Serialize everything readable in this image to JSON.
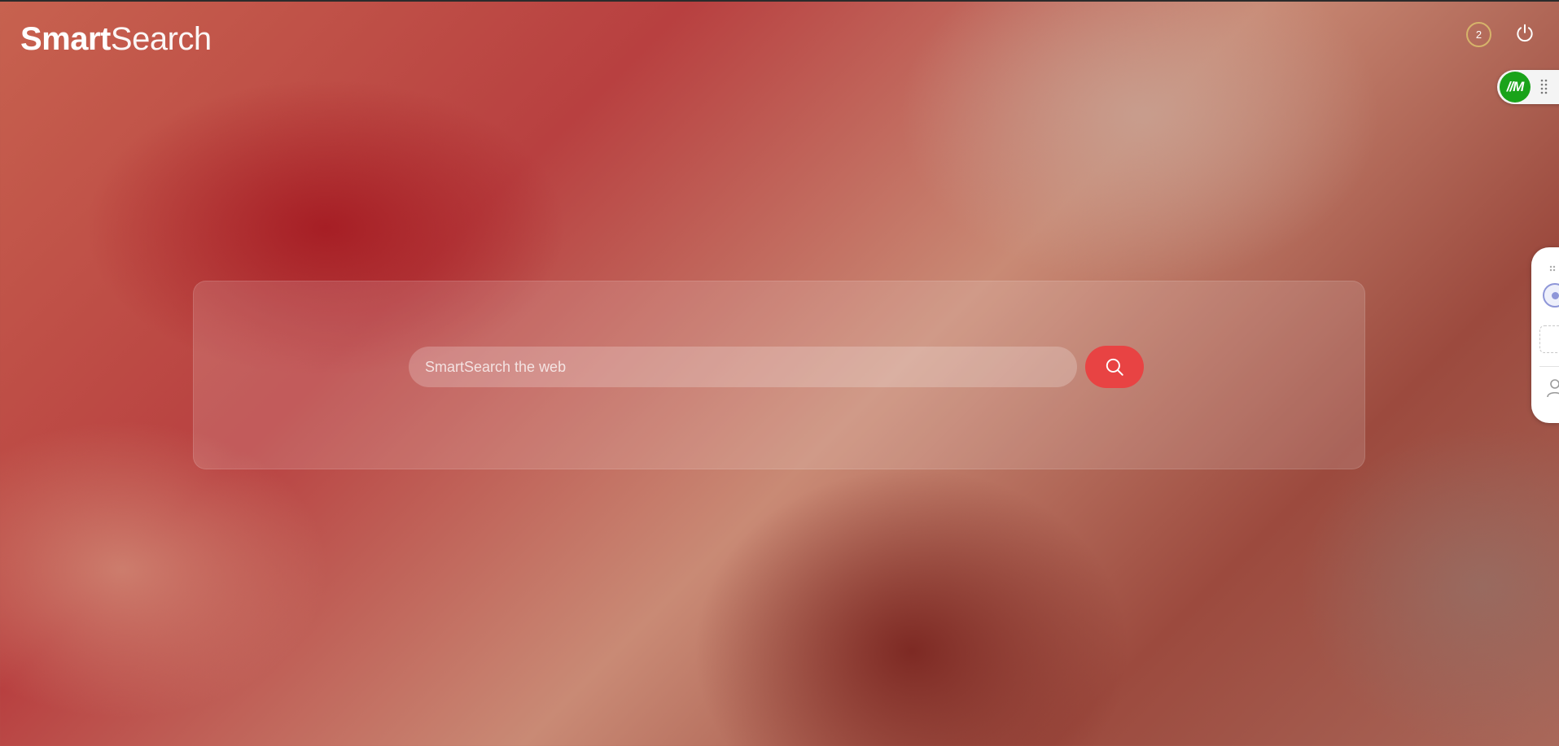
{
  "header": {
    "logo_bold": "Smart",
    "logo_light": "Search",
    "notification_count": "2",
    "power_icon": "power-icon"
  },
  "extension": {
    "logo_text": "//M",
    "logo_color": "#1aa31a",
    "grip_icon": "drag-handle-icon"
  },
  "side_panel": {
    "icons": [
      "grip-dots-icon",
      "radio-circle-icon",
      "dashed-box-icon",
      "user-icon"
    ]
  },
  "search": {
    "placeholder": "SmartSearch the web",
    "button_icon": "search-icon",
    "button_color": "#e84343"
  }
}
